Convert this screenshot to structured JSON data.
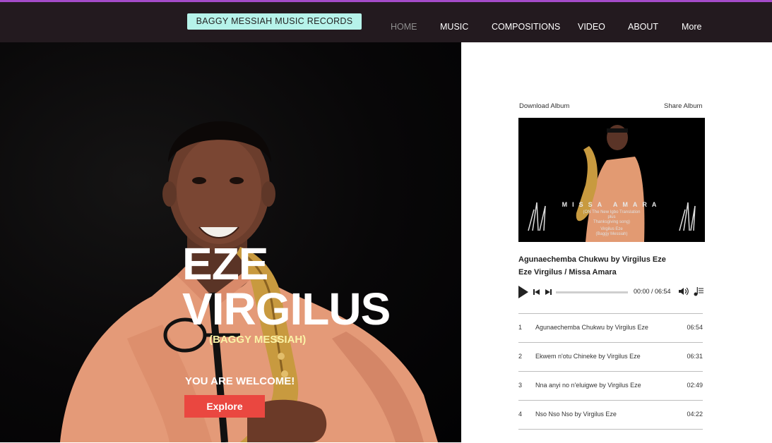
{
  "header": {
    "brand": "BAGGY MESSIAH MUSIC RECORDS",
    "nav": [
      {
        "label": "HOME",
        "active": true
      },
      {
        "label": "MUSIC"
      },
      {
        "label": "COMPOSITIONS"
      },
      {
        "label": "VIDEO"
      },
      {
        "label": "ABOUT"
      },
      {
        "label": "More"
      }
    ]
  },
  "hero": {
    "title_line1": "EZE",
    "title_line2": "VIRGILUS",
    "subtitle": "(BAGGY MESSIAH)",
    "welcome": "YOU ARE WELCOME!",
    "cta": "Explore"
  },
  "album": {
    "download": "Download Album",
    "share": "Share Album",
    "cover": {
      "title": "MISSA AMARA",
      "subtitle_l1": "(ON The New Igbo Translation",
      "subtitle_l2": "plus",
      "subtitle_l3": "Thanksgiving song)",
      "artist_l1": "Virgilus Eze",
      "artist_l2": "(Baggy Messiah)"
    },
    "now_playing": {
      "title": "Agunaechemba Chukwu by Virgilus Eze",
      "artist": "Eze Virgilus / Missa Amara",
      "time": "00:00 / 06:54",
      "progress": 0
    },
    "tracks": [
      {
        "num": "1",
        "name": "Agunaechemba Chukwu by Virgilus Eze",
        "duration": "06:54"
      },
      {
        "num": "2",
        "name": "Ekwem n'otu Chineke by Virgilus Eze",
        "duration": "06:31"
      },
      {
        "num": "3",
        "name": "Nna anyi no n'eluigwe by Virgilus Eze",
        "duration": "02:49"
      },
      {
        "num": "4",
        "name": "Nso Nso Nso by Virgilus Eze",
        "duration": "04:22"
      }
    ]
  },
  "colors": {
    "accent": "#a44bc9",
    "header_bg": "#231a1f",
    "brand_bg": "#b6f3ea",
    "cta_bg": "#ea4740",
    "subtitle": "#fbf3a6"
  }
}
